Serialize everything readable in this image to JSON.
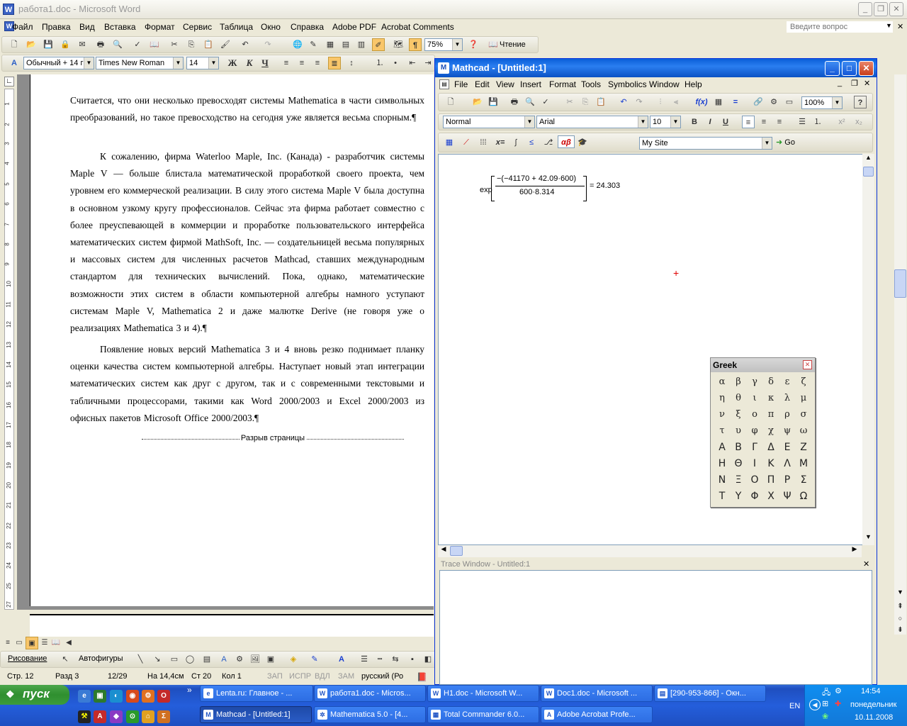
{
  "word": {
    "title": "работа1.doc - Microsoft Word",
    "menu": [
      "Файл",
      "Правка",
      "Вид",
      "Вставка",
      "Формат",
      "Сервис",
      "Таблица",
      "Окно",
      "Справка",
      "Adobe PDF",
      "Acrobat Comments"
    ],
    "ask_placeholder": "Введите вопрос",
    "zoom": "75%",
    "read_label": "Чтение",
    "style": "Обычный + 14 г",
    "font": "Times New Roman",
    "size": "14",
    "bold": "Ж",
    "italic": "К",
    "underline": "Ч",
    "paragraphs": [
      "Считается, что они несколько превосходят системы Mathematica в части символьных преобразований, но такое превосходство на сегодня уже является весьма спорным.¶",
      "К сожалению, фирма Waterloo Maple, Inc. (Канада) - разработчик системы Maple V — больше блистала математической проработкой своего проекта, чем уровнем его коммерческой реализации. В силу этого система Maple V была доступна в основном узкому кругу профессионалов. Сейчас эта фирма работает совместно с более преуспевающей в коммерции и проработке пользовательского интерфейса математических систем фирмой MathSoft, Inc. — создательницей весьма популярных и массовых систем для численных расчетов Mathcad, ставших международным стандартом для технических вычислений. Пока, однако, математические возможности этих систем в области компьютерной алгебры намного уступают системам Maple V, Mathematica 2 и даже малютке Derive (не говоря уже о реализациях Mathematica 3 и 4).¶",
      "Появление новых версий Mathematica 3 и 4 вновь резко поднимает планку оценки качества систем компьютерной алгебры. Наступает новый этап интеграции математических систем как друг с другом, так и с современными текстовыми и табличными процессорами, такими как Word 2000/2003 и Excel 2000/2003 из офисных пакетов Microsoft Office 2000/2003.¶"
    ],
    "page_break": "Разрыв страницы",
    "ruler_numbers": [
      "1",
      "2",
      "3",
      "4",
      "5",
      "6",
      "7",
      "8",
      "9",
      "10",
      "11",
      "12",
      "13",
      "14",
      "15",
      "16",
      "17",
      "18",
      "19",
      "20",
      "21",
      "22",
      "23",
      "24",
      "25",
      "27"
    ],
    "drawing_label": "Рисование",
    "autoshapes_label": "Автофигуры",
    "status": {
      "page": "Стр. 12",
      "section": "Разд 3",
      "pages": "12/29",
      "at": "На 14,4см",
      "line": "Ст 20",
      "col": "Кол 1",
      "rec": "ЗАП",
      "trk": "ИСПР",
      "ext": "ВДЛ",
      "ovr": "ЗАМ",
      "lang": "русский (Ро"
    }
  },
  "mathcad": {
    "title": "Mathcad - [Untitled:1]",
    "menu": [
      "File",
      "Edit",
      "View",
      "Insert",
      "Format",
      "Tools",
      "Symbolics",
      "Window",
      "Help"
    ],
    "zoom": "100%",
    "style": "Normal",
    "font": "Arial",
    "size": "10",
    "bold": "B",
    "italic": "I",
    "underline": "U",
    "site": "My Site",
    "go": "Go",
    "greek_label": "αβ",
    "expr": {
      "func": "exp",
      "numerator": "−(−41170 + 42.09·600)",
      "denominator": "600·8.314",
      "result": "= 24.303"
    },
    "trace_title": "Trace Window - Untitled:1"
  },
  "greek": {
    "title": "Greek",
    "rows": [
      [
        "α",
        "β",
        "γ",
        "δ",
        "ε",
        "ζ"
      ],
      [
        "η",
        "θ",
        "ι",
        "κ",
        "λ",
        "μ"
      ],
      [
        "ν",
        "ξ",
        "ο",
        "π",
        "ρ",
        "σ"
      ],
      [
        "τ",
        "υ",
        "φ",
        "χ",
        "ψ",
        "ω"
      ],
      [
        "Α",
        "Β",
        "Γ",
        "Δ",
        "Ε",
        "Ζ"
      ],
      [
        "Η",
        "Θ",
        "Ι",
        "Κ",
        "Λ",
        "Μ"
      ],
      [
        "Ν",
        "Ξ",
        "Ο",
        "Π",
        "Ρ",
        "Σ"
      ],
      [
        "Τ",
        "Υ",
        "Φ",
        "Χ",
        "Ψ",
        "Ω"
      ]
    ]
  },
  "taskbar": {
    "start": "пуск",
    "tasks_row1": [
      "Lenta.ru: Главное - ...",
      "работа1.doc - Micros...",
      "H1.doc - Microsoft W...",
      "Doc1.doc - Microsoft ...",
      "[290-953-866] - Окн..."
    ],
    "tasks_row2": [
      "Mathcad - [Untitled:1]",
      "Mathematica 5.0 - [4...",
      "Total Commander 6.0...",
      "Adobe Acrobat Profe..."
    ],
    "lang": "EN",
    "time": "14:54",
    "day": "понедельник",
    "date": "10.11.2008"
  },
  "colors": {
    "xp_blue": "#245edb",
    "start_green": "#3c9c3c",
    "cursor_red": "#e00000"
  }
}
